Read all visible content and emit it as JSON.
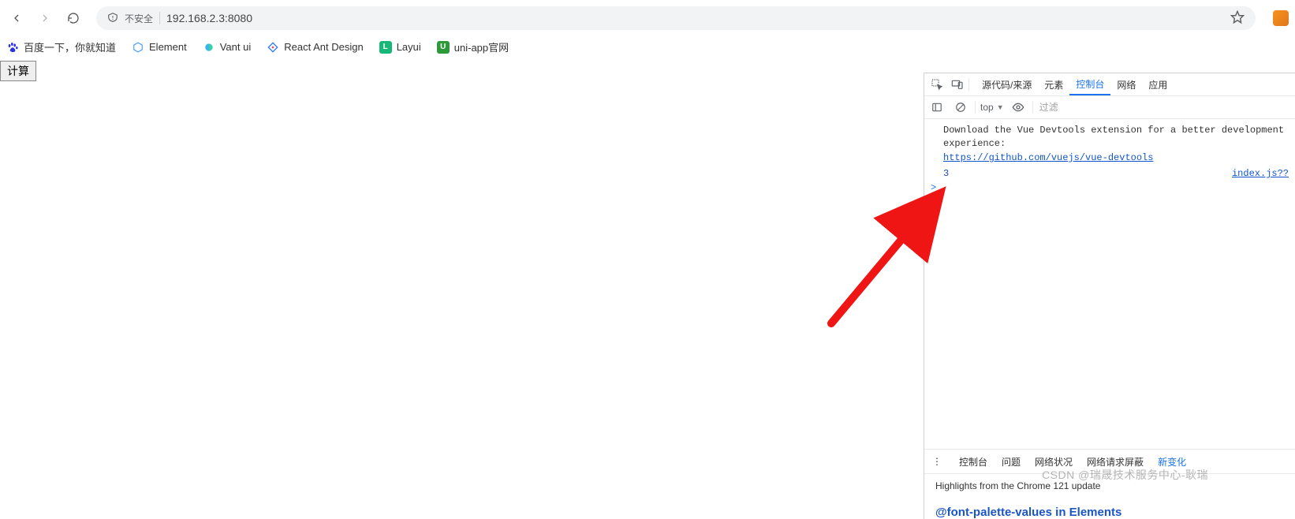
{
  "browser": {
    "insecure_label": "不安全",
    "url": "192.168.2.3:8080"
  },
  "bookmarks": [
    {
      "label": "百度一下，你就知道"
    },
    {
      "label": "Element"
    },
    {
      "label": "Vant ui"
    },
    {
      "label": "React Ant Design"
    },
    {
      "label": "Layui"
    },
    {
      "label": "uni-app官网"
    }
  ],
  "page": {
    "calc_button": "计算"
  },
  "devtools": {
    "tabs": {
      "sources": "源代码/来源",
      "elements": "元素",
      "console": "控制台",
      "network": "网络",
      "application": "应用"
    },
    "context": "top",
    "filter_placeholder": "过滤",
    "messages": {
      "vue_devtools_text": "Download the Vue Devtools extension for a better development experience:",
      "vue_devtools_link": "https://github.com/vuejs/vue-devtools",
      "log_value": "3",
      "log_source": "index.js??"
    },
    "footer_tabs": {
      "console": "控制台",
      "issues": "问题",
      "net_conditions": "网络状况",
      "net_block": "网络请求屏蔽",
      "whatsnew": "新变化"
    },
    "highlights": "Highlights from the Chrome 121 update",
    "news_headline": "@font-palette-values in Elements"
  },
  "watermark": "CSDN @瑞晟技术服务中心-耿瑞"
}
